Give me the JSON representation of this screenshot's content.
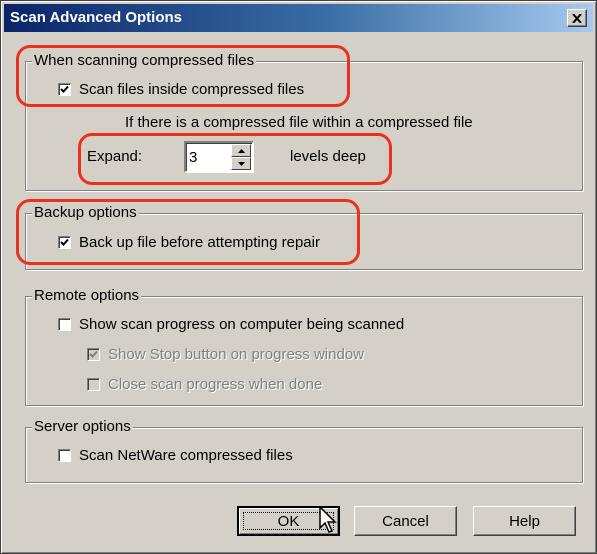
{
  "window": {
    "title": "Scan Advanced Options",
    "close_glyph": "×"
  },
  "compressed_group": {
    "legend": "When scanning compressed files",
    "scan_inside_label": "Scan files inside compressed files",
    "scan_inside_checked": true,
    "nested_text": "If there is a compressed file within a compressed file",
    "expand_label": "Expand:",
    "expand_value": "3",
    "levels_label": "levels deep"
  },
  "backup_group": {
    "legend": "Backup options",
    "backup_label": "Back up file before attempting repair",
    "backup_checked": true
  },
  "remote_group": {
    "legend": "Remote options",
    "show_progress_label": "Show scan progress on computer being scanned",
    "show_progress_checked": false,
    "show_stop_label": "Show Stop button on progress window",
    "show_stop_checked": true,
    "close_progress_label": "Close scan progress when done",
    "close_progress_checked": false
  },
  "server_group": {
    "legend": "Server options",
    "netware_label": "Scan NetWare compressed files",
    "netware_checked": false
  },
  "buttons": {
    "ok": "OK",
    "cancel": "Cancel",
    "help": "Help"
  },
  "colors": {
    "highlight": "#e8321e",
    "face": "#d4d0c8",
    "title_start": "#0a246a"
  }
}
